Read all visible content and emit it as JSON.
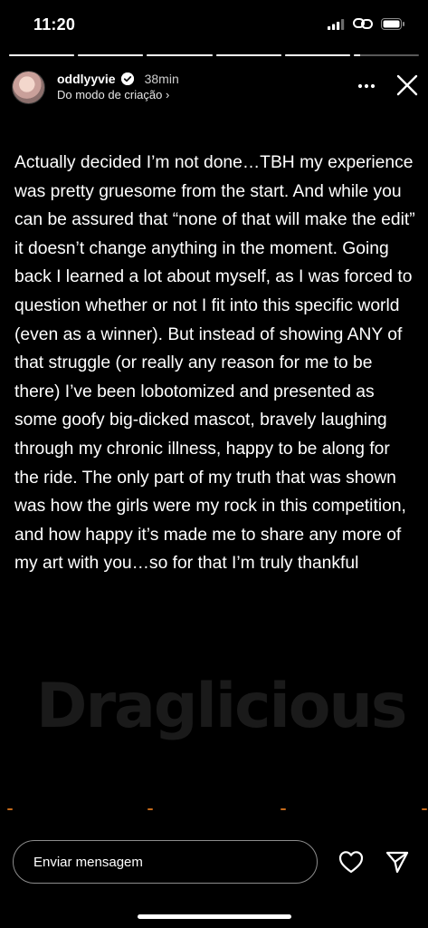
{
  "status_bar": {
    "time": "11:20",
    "icons": [
      "cellular-signal-icon",
      "link-icon",
      "battery-icon"
    ]
  },
  "story": {
    "segment_count": 6,
    "active_segment": 5,
    "active_segment_progress": 0.1
  },
  "header": {
    "username": "oddlyyvie",
    "verified": true,
    "time_ago": "38min",
    "subtitle": "Do modo de criação ›"
  },
  "content": {
    "text": "Actually decided I’m not done…TBH my experience  was pretty gruesome from the start. And while you can be assured that “none of that will make the edit” it doesn’t change anything in the moment. Going back I learned a lot about myself, as I was forced to question whether or not I fit into this specific world (even as a winner). But instead of showing ANY of that struggle (or really any reason for me to be there) I’ve been lobotomized and presented as some goofy big-dicked mascot, bravely laughing through my chronic illness, happy to be along for the ride.  The only part of my truth that was shown was how the girls were my rock in this competition, and how happy it’s made me to share any more of my art with you…so for that I’m truly thankful"
  },
  "watermark": {
    "text": "Draglicious"
  },
  "footer": {
    "reply_placeholder": "Enviar mensagem"
  },
  "colors": {
    "background": "#000000",
    "text": "#ffffff",
    "accent_dots": "#c56a1a"
  }
}
